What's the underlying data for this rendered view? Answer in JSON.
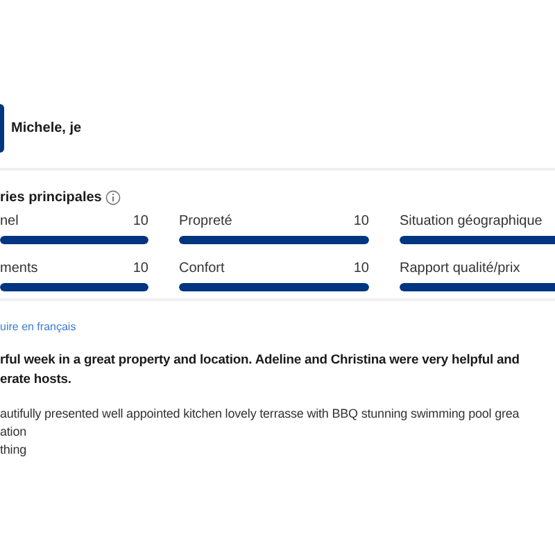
{
  "reviewer": {
    "name": "Michele, je"
  },
  "categories": {
    "title": "ries principales",
    "items": [
      {
        "label": "nel",
        "value": "10",
        "level": 1
      },
      {
        "label": "Propreté",
        "value": "10",
        "level": 1
      },
      {
        "label": "Situation géographique",
        "level": 1
      },
      {
        "label": "ments",
        "value": "10",
        "level": 1
      },
      {
        "label": "Confort",
        "value": "10",
        "level": 1
      },
      {
        "label": "Rapport qualité/prix",
        "level": 1
      }
    ]
  },
  "translate_link": "uire en français",
  "review": {
    "title_lines": [
      "rful week in a great property and location. Adeline and Christina were very helpful and",
      "erate hosts."
    ],
    "body_lines": [
      "autifully presented well appointed kitchen lovely terrasse with BBQ stunning swimming pool grea",
      "ation",
      "thing"
    ]
  }
}
